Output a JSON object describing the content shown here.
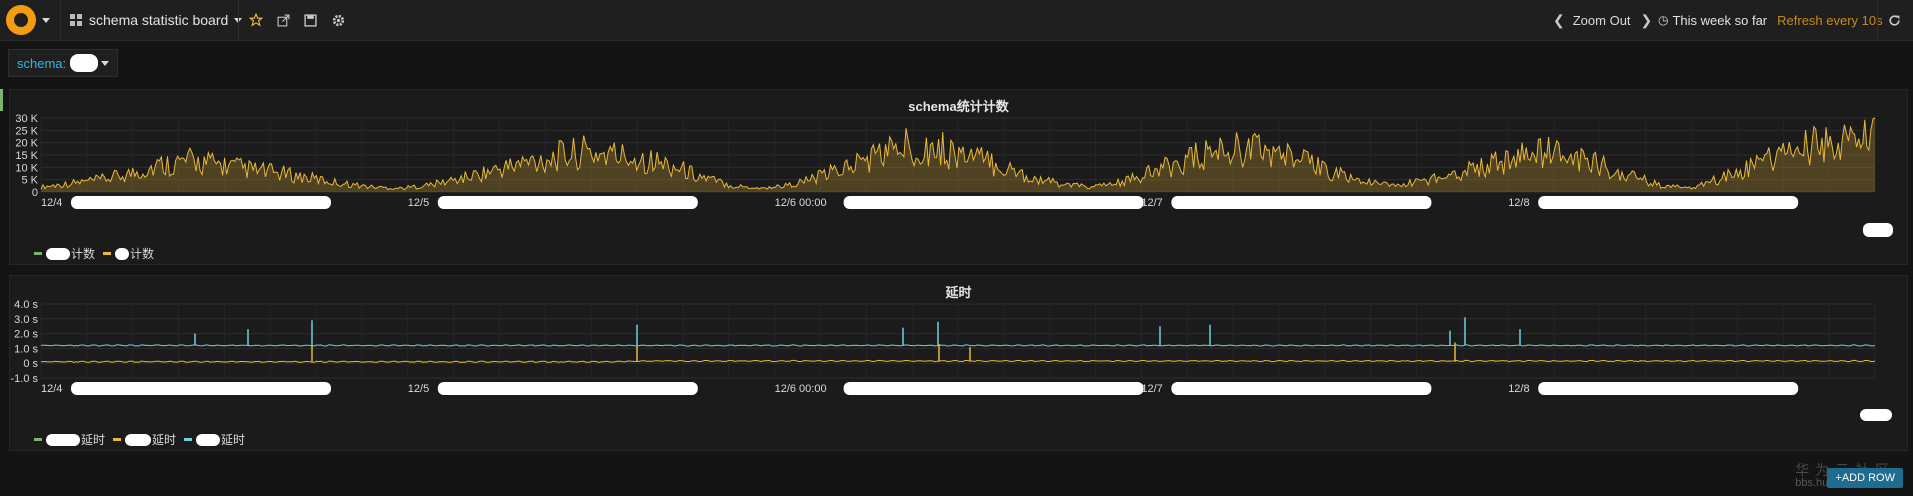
{
  "topbar": {
    "dashboard_title": "schema statistic board",
    "zoom_out_label": "Zoom Out",
    "time_range_label": "This week so far",
    "refresh_label": "Refresh every 10s"
  },
  "variables": [
    {
      "label": "schema:",
      "value": ""
    }
  ],
  "panels": [
    {
      "title": "schema统计计数",
      "legend": [
        {
          "label": "计数",
          "color": "#7eb26d"
        },
        {
          "label": "计数",
          "color": "#eab839"
        }
      ]
    },
    {
      "title": "延时",
      "legend": [
        {
          "label": "延时",
          "color": "#7eb26d"
        },
        {
          "label": "延时",
          "color": "#eab839"
        },
        {
          "label": "延时",
          "color": "#6ed0e0"
        }
      ]
    }
  ],
  "chart_data": [
    {
      "type": "area",
      "title": "schema统计计数",
      "x_tick_labels": [
        "12/4",
        "12/5",
        "12/6 00:00",
        "12/7",
        "12/8"
      ],
      "y_tick_labels": [
        "0",
        "5 K",
        "10 K",
        "15 K",
        "20 K",
        "25 K",
        "30 K"
      ],
      "ylim": [
        0,
        30000
      ],
      "grid": true,
      "series": [
        {
          "values": [
            2000,
            3500,
            5000,
            7500,
            11000,
            12500,
            11000,
            9000,
            7500,
            5500,
            3500,
            2000,
            1500,
            3000,
            5500,
            8500,
            11500,
            14000,
            16000,
            15000,
            13500,
            10500,
            6000,
            2500,
            1500,
            3000,
            6500,
            11000,
            16000,
            19000,
            17000,
            14000,
            10000,
            5500,
            3000,
            2000,
            4000,
            8000,
            12500,
            16000,
            18000,
            16000,
            12000,
            8000,
            4000,
            2500,
            4500,
            7500,
            10500,
            13500,
            16000,
            14000,
            10000,
            6000,
            2000,
            2000,
            6000,
            11000,
            15000,
            18500,
            20000,
            22000
          ]
        }
      ]
    },
    {
      "type": "line",
      "title": "延时",
      "x_tick_labels": [
        "12/4",
        "12/5",
        "12/6 00:00",
        "12/7",
        "12/8"
      ],
      "y_tick_labels": [
        "-1.0 s",
        "0 s",
        "1.0 s",
        "2.0 s",
        "3.0 s",
        "4.0 s"
      ],
      "ylim": [
        -1.0,
        4.0
      ],
      "grid": true,
      "series": [
        {
          "values": [
            1.2,
            1.2,
            1.2,
            1.2,
            1.2,
            1.2,
            1.2,
            1.2,
            1.2,
            1.2,
            1.2,
            1.2,
            1.2,
            1.2,
            1.2,
            1.2,
            1.2,
            1.2,
            1.2,
            1.2,
            1.2,
            1.2,
            1.2,
            1.2,
            1.2,
            1.2,
            1.2,
            1.2,
            1.2,
            1.2,
            1.2,
            1.2,
            1.2,
            1.2,
            1.2,
            1.2,
            1.2,
            1.2,
            1.2,
            1.2,
            1.2,
            1.2,
            1.2,
            1.2,
            1.2,
            1.2,
            1.2,
            1.2,
            1.2,
            1.2,
            1.2,
            1.2,
            1.2,
            1.2,
            1.2,
            1.2,
            1.2,
            1.2,
            1.2,
            1.2,
            1.2,
            1.2
          ]
        },
        {
          "values": [
            0.1,
            0.1,
            0.1,
            0.1,
            0.1,
            0.1,
            0.1,
            0.1,
            0.1,
            0.1,
            0.1,
            0.1,
            0.1,
            0.1,
            0.1,
            0.1,
            0.1,
            0.1,
            0.1,
            0.1,
            0.15,
            0.15,
            0.15,
            0.15,
            0.15,
            0.15,
            0.15,
            0.15,
            0.15,
            0.15,
            0.15,
            0.15,
            0.15,
            0.15,
            0.15,
            0.15,
            0.15,
            0.15,
            0.15,
            0.15,
            0.15,
            0.15,
            0.15,
            0.15,
            0.15,
            0.15,
            0.15,
            0.15,
            0.15,
            0.15,
            0.15,
            0.15,
            0.15,
            0.15,
            0.15,
            0.15,
            0.15,
            0.15,
            0.15,
            0.15,
            0.15,
            0.15
          ]
        }
      ]
    }
  ],
  "add_row_label": "+ADD ROW",
  "watermark": {
    "line1": "华为云社区",
    "line2": "bbs.huaweicloud.com"
  },
  "colors": {
    "accent": "#eab839",
    "cyan": "#6ed0e0",
    "green": "#7eb26d",
    "background": "#141414"
  }
}
